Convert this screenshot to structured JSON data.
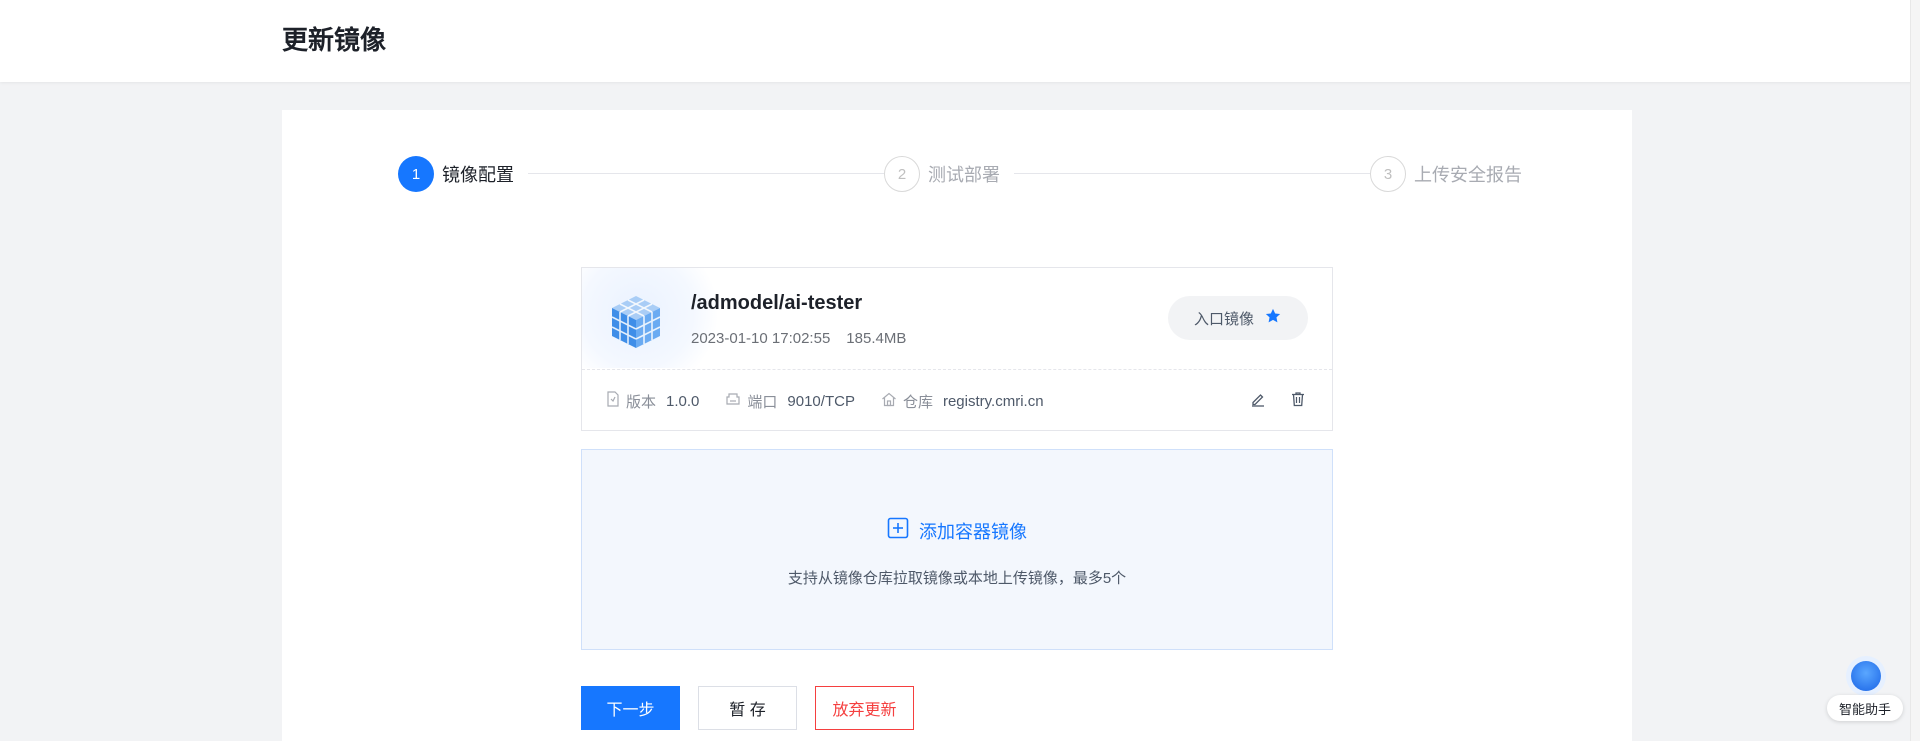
{
  "header": {
    "title": "更新镜像"
  },
  "steps": [
    {
      "number": "1",
      "label": "镜像配置",
      "state": "active"
    },
    {
      "number": "2",
      "label": "测试部署",
      "state": "pending"
    },
    {
      "number": "3",
      "label": "上传安全报告",
      "state": "pending"
    }
  ],
  "image": {
    "name": "/admodel/ai-tester",
    "created": "2023-01-10 17:02:55",
    "size": "185.4MB",
    "entry_label": "入口镜像",
    "version_key": "版本",
    "version_value": "1.0.0",
    "port_key": "端口",
    "port_value": "9010/TCP",
    "repo_key": "仓库",
    "repo_value": "registry.cmri.cn"
  },
  "add_image": {
    "label": "添加容器镜像",
    "hint": "支持从镜像仓库拉取镜像或本地上传镜像，最多5个"
  },
  "actions": {
    "next": "下一步",
    "save_draft": "暂 存",
    "abandon": "放弃更新"
  },
  "assistant": {
    "label": "智能助手"
  },
  "colors": {
    "primary": "#1677ff",
    "danger": "#f53f3f",
    "page_bg": "#f2f3f5"
  },
  "icons": {
    "image": "cube-icon",
    "entry": "star-icon",
    "version": "file-version-icon",
    "port": "port-icon",
    "repo": "home-icon",
    "edit": "pencil-icon",
    "delete": "trash-icon",
    "add": "plus-square-icon"
  }
}
